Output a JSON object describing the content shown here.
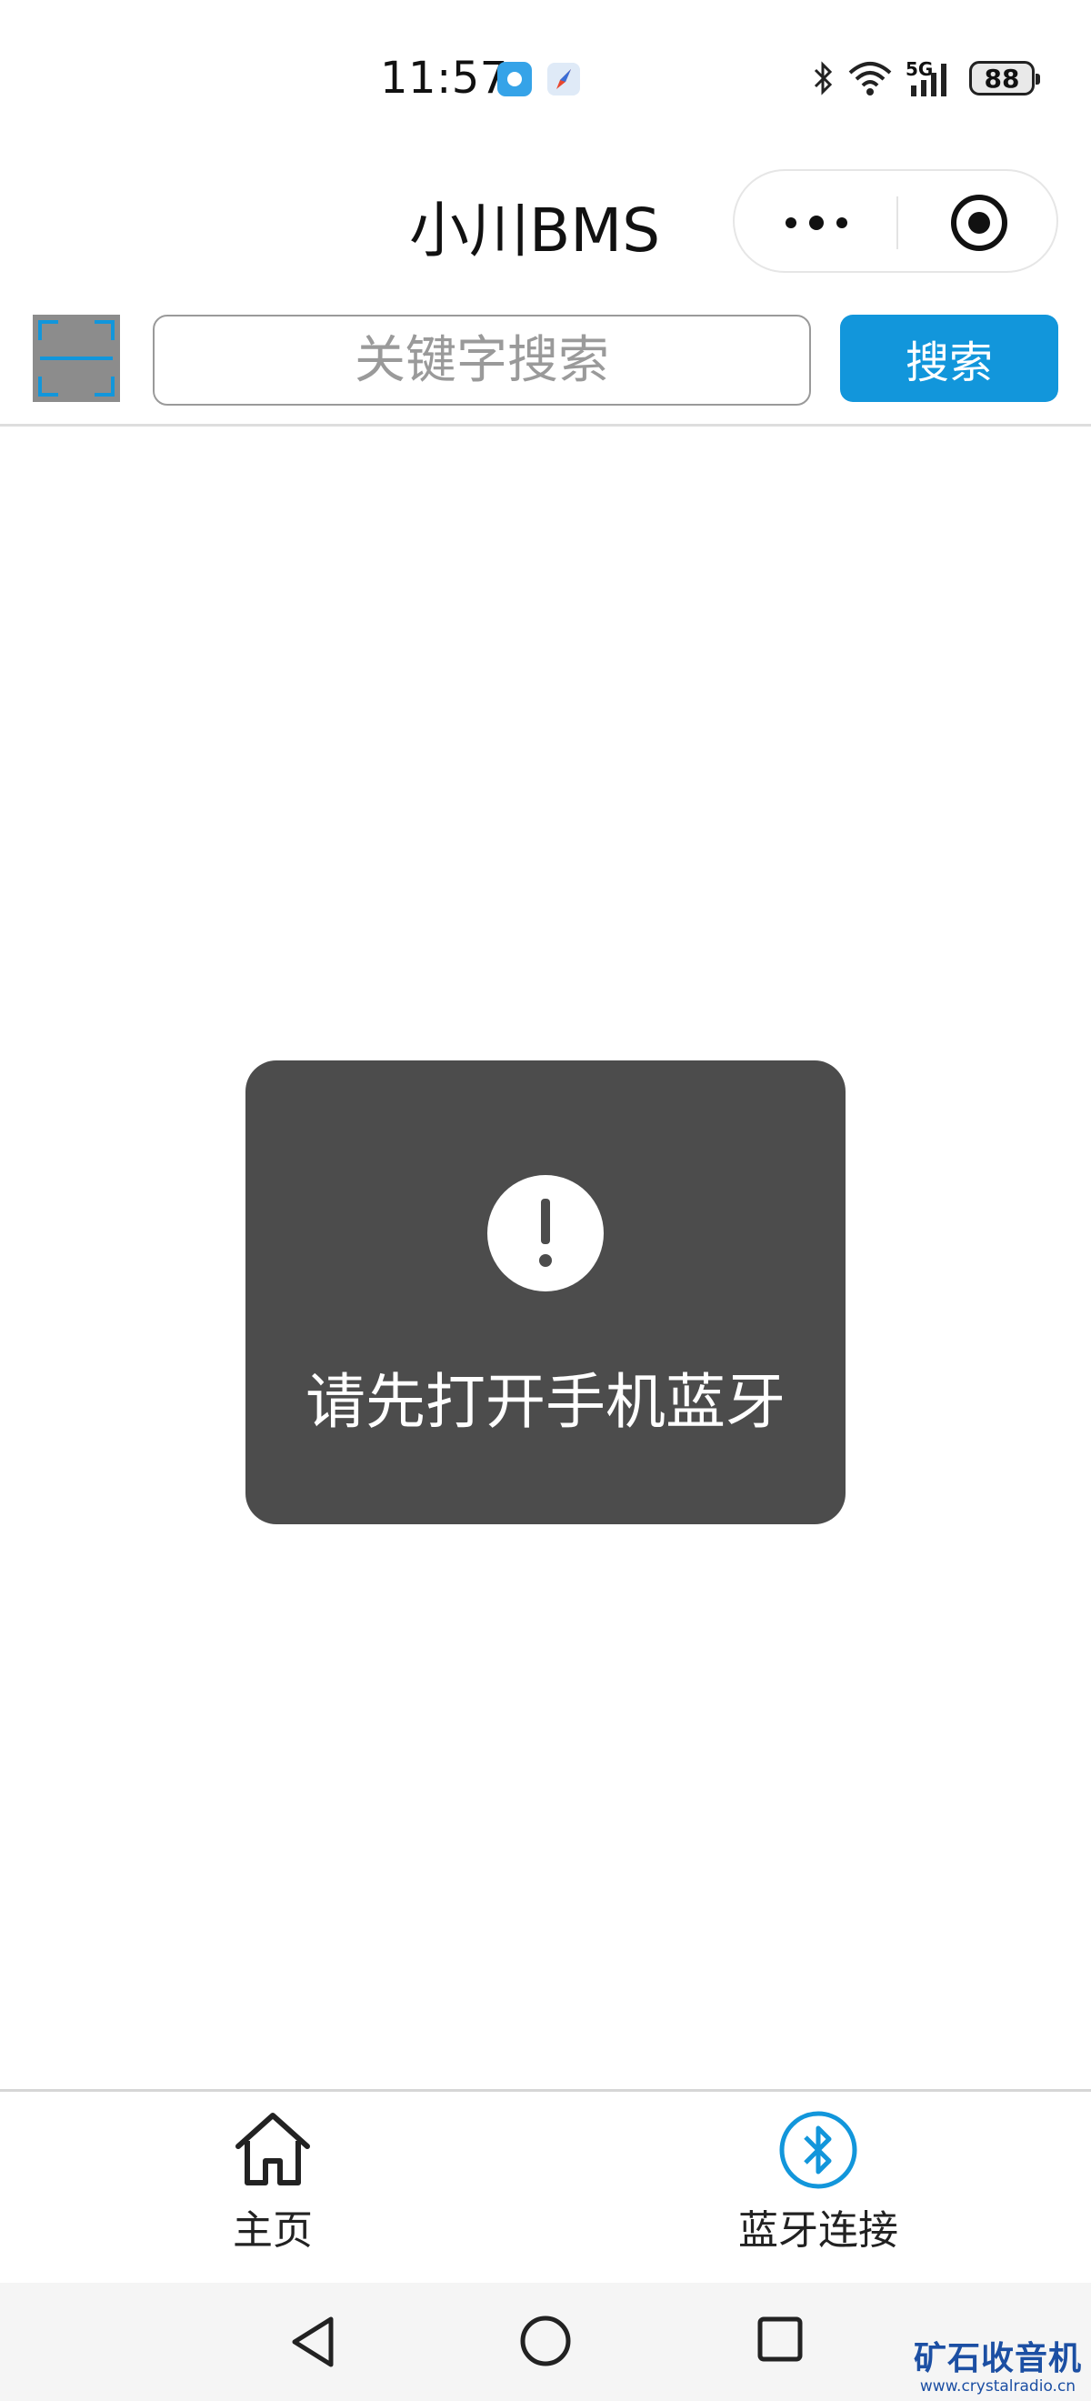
{
  "status_bar": {
    "time": "11:57",
    "network": "5G",
    "battery": "88"
  },
  "header": {
    "title": "小川BMS"
  },
  "search": {
    "placeholder": "关键字搜索",
    "value": "",
    "button_label": "搜索"
  },
  "toast": {
    "message": "请先打开手机蓝牙"
  },
  "tabbar": {
    "items": [
      {
        "label": "主页",
        "icon": "home-icon"
      },
      {
        "label": "蓝牙连接",
        "icon": "bluetooth-icon",
        "active": true
      }
    ]
  },
  "watermark": {
    "title": "矿石收音机",
    "url": "www.crystalradio.cn"
  },
  "colors": {
    "accent": "#1296db",
    "toast_bg": "#4c4c4c",
    "scan_bg": "#8c8c8c"
  }
}
